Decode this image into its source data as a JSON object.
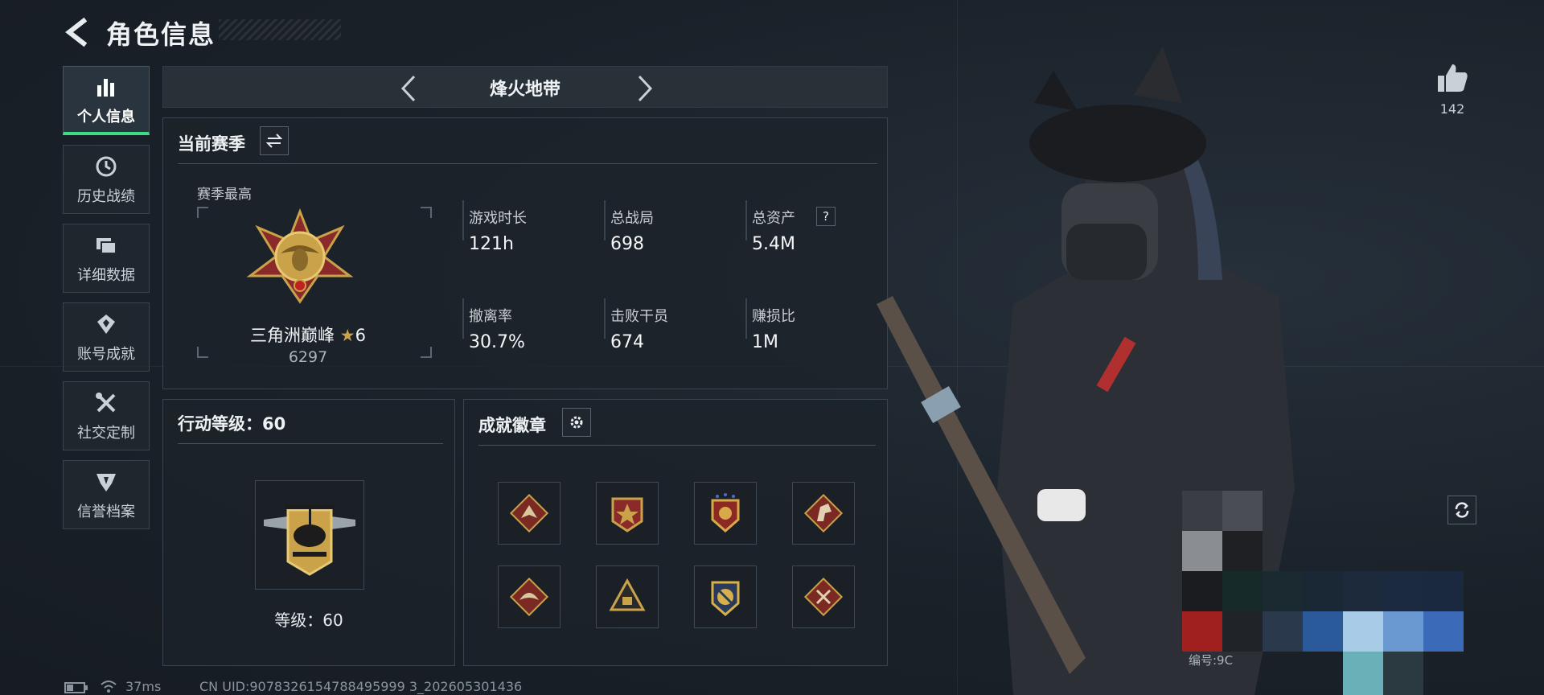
{
  "header": {
    "title": "角色信息"
  },
  "sidebar": {
    "items": [
      {
        "label": "个人信息",
        "icon": "bar-chart-icon"
      },
      {
        "label": "历史战绩",
        "icon": "clock-history-icon"
      },
      {
        "label": "详细数据",
        "icon": "folders-icon"
      },
      {
        "label": "账号成就",
        "icon": "achievement-icon"
      },
      {
        "label": "社交定制",
        "icon": "tools-icon"
      },
      {
        "label": "信誉档案",
        "icon": "reputation-icon"
      }
    ]
  },
  "mode_tab": {
    "label": "烽火地带"
  },
  "season": {
    "title": "当前赛季",
    "best_label": "赛季最高",
    "rank_name": "三角洲巅峰",
    "rank_stars": "6",
    "rank_points": "6297",
    "stats": [
      {
        "label": "游戏时长",
        "value": "121h"
      },
      {
        "label": "总战局",
        "value": "698"
      },
      {
        "label": "总资产",
        "value": "5.4M",
        "help": "?"
      },
      {
        "label": "撤离率",
        "value": "30.7%"
      },
      {
        "label": "击败干员",
        "value": "674"
      },
      {
        "label": "赚损比",
        "value": "1M"
      }
    ]
  },
  "level": {
    "title": "行动等级：60",
    "badge_label": "等级：60"
  },
  "achievements": {
    "title": "成就徽章",
    "badges": [
      "wolf-badge-icon",
      "star-cross-badge-icon",
      "shield-badge-icon",
      "horse-badge-icon",
      "dragon-badge-icon",
      "pyramid-badge-icon",
      "crest-badge-icon",
      "tools-badge-icon"
    ]
  },
  "likes": {
    "count": "142"
  },
  "partial_text": "编号:9C",
  "status": {
    "ping": "37ms",
    "uid": "CN UID:9078326154788495999 3_202605301436"
  },
  "colors": {
    "accent": "#3ddc84",
    "background": "#1b222a",
    "gold": "#c9a24a"
  }
}
